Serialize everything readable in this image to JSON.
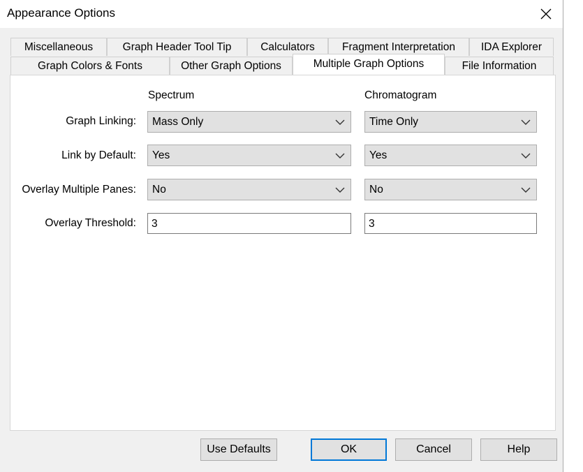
{
  "window": {
    "title": "Appearance Options"
  },
  "tabs_row1": [
    {
      "label": "Miscellaneous"
    },
    {
      "label": "Graph Header Tool Tip"
    },
    {
      "label": "Calculators"
    },
    {
      "label": "Fragment Interpretation"
    },
    {
      "label": "IDA Explorer"
    }
  ],
  "tabs_row2": [
    {
      "label": "Graph Colors & Fonts"
    },
    {
      "label": "Other Graph Options"
    },
    {
      "label": "Multiple Graph Options",
      "active": true
    },
    {
      "label": "File Information"
    }
  ],
  "columns": {
    "spectrum": "Spectrum",
    "chromatogram": "Chromatogram"
  },
  "rows": {
    "graph_linking": {
      "label": "Graph Linking:",
      "spectrum": "Mass Only",
      "chromatogram": "Time Only"
    },
    "link_by_default": {
      "label": "Link by Default:",
      "spectrum": "Yes",
      "chromatogram": "Yes"
    },
    "overlay_multiple_panes": {
      "label": "Overlay Multiple Panes:",
      "spectrum": "No",
      "chromatogram": "No"
    },
    "overlay_threshold": {
      "label": "Overlay Threshold:",
      "spectrum": "3",
      "chromatogram": "3"
    }
  },
  "buttons": {
    "use_defaults": "Use Defaults",
    "ok": "OK",
    "cancel": "Cancel",
    "help": "Help"
  },
  "icons": {
    "close": "close-icon",
    "dropdown": "chevron-down-icon"
  }
}
